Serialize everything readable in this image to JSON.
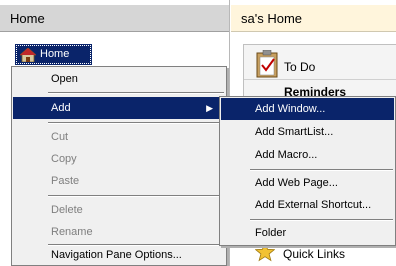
{
  "nav": {
    "header": "Home",
    "home_label": "Home"
  },
  "content": {
    "header": "sa's Home",
    "todo_title": "To Do",
    "reminders": "Reminders",
    "quick_links": "Quick Links"
  },
  "context_menu": {
    "open": "Open",
    "add": "Add",
    "cut": "Cut",
    "copy": "Copy",
    "paste": "Paste",
    "delete": "Delete",
    "rename": "Rename",
    "nav_options": "Navigation Pane Options..."
  },
  "add_submenu": {
    "add_window": "Add Window...",
    "add_smartlist": "Add SmartList...",
    "add_macro": "Add Macro...",
    "add_web_page": "Add Web Page...",
    "add_external_shortcut": "Add External Shortcut...",
    "folder": "Folder"
  },
  "colors": {
    "selection": "#0a246a",
    "nav_header_bg": "#d6d6d6",
    "content_header_bg": "#fff5dc"
  }
}
